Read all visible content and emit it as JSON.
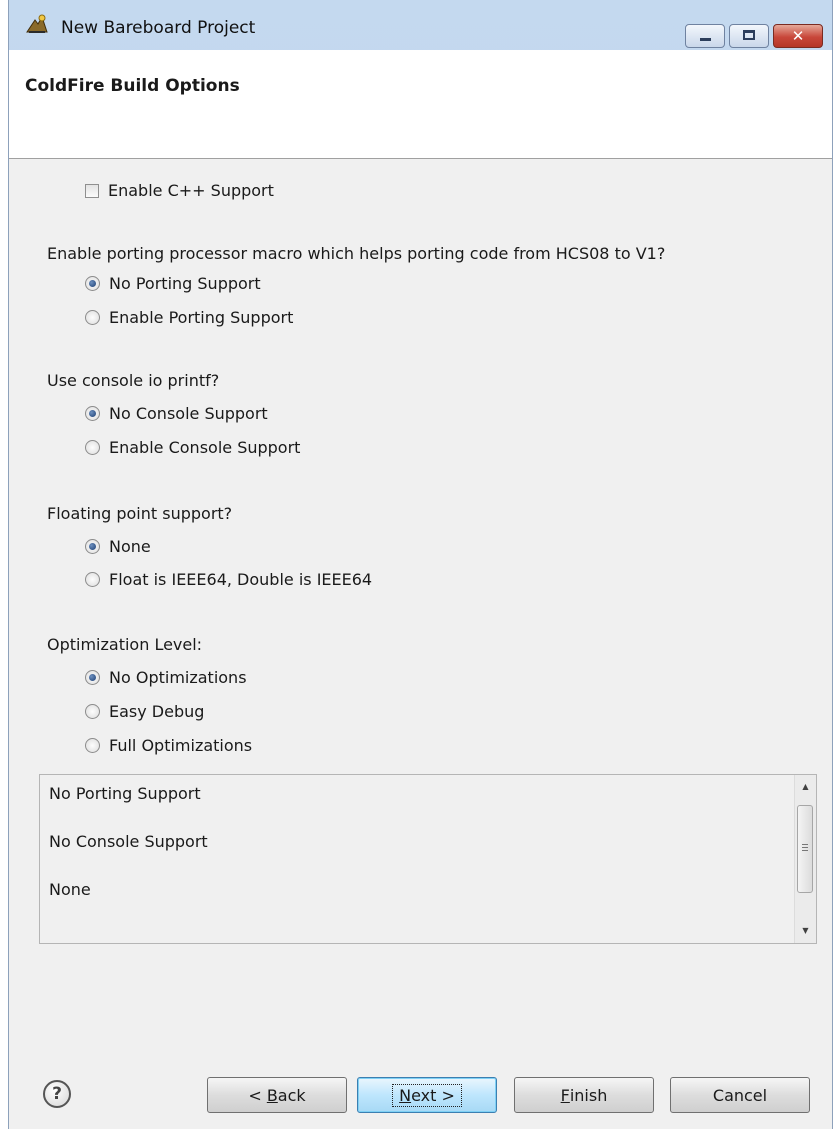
{
  "window": {
    "title": "New Bareboard Project"
  },
  "header": {
    "title": "ColdFire Build Options"
  },
  "cpp": {
    "label": "Enable C++ Support",
    "checked": false
  },
  "porting": {
    "question": "Enable porting processor macro which helps porting code from HCS08 to V1?",
    "options": [
      "No Porting Support",
      "Enable Porting Support"
    ],
    "selected": "No Porting Support"
  },
  "console": {
    "question": "Use console io printf?",
    "options": [
      "No Console Support",
      "Enable Console Support"
    ],
    "selected": "No Console Support"
  },
  "floating": {
    "question": "Floating point support?",
    "options": [
      "None",
      "Float is IEEE64, Double is IEEE64"
    ],
    "selected": "None"
  },
  "optimization": {
    "question": "Optimization Level:",
    "options": [
      "No Optimizations",
      "Easy Debug",
      "Full Optimizations"
    ],
    "selected": "No Optimizations"
  },
  "summary": {
    "lines": [
      "No Porting Support",
      "No Console Support",
      "None"
    ]
  },
  "buttons": {
    "back": {
      "prefix": "< ",
      "mnemonic": "B",
      "rest": "ack"
    },
    "next": {
      "mnemonic": "N",
      "rest": "ext >"
    },
    "finish": {
      "mnemonic": "F",
      "rest": "inish"
    },
    "cancel": "Cancel"
  },
  "icons": {
    "app": "project-wizard-icon",
    "help": "help-icon",
    "minimize": "minimize-icon",
    "maximize": "maximize-icon",
    "close": "close-icon"
  }
}
